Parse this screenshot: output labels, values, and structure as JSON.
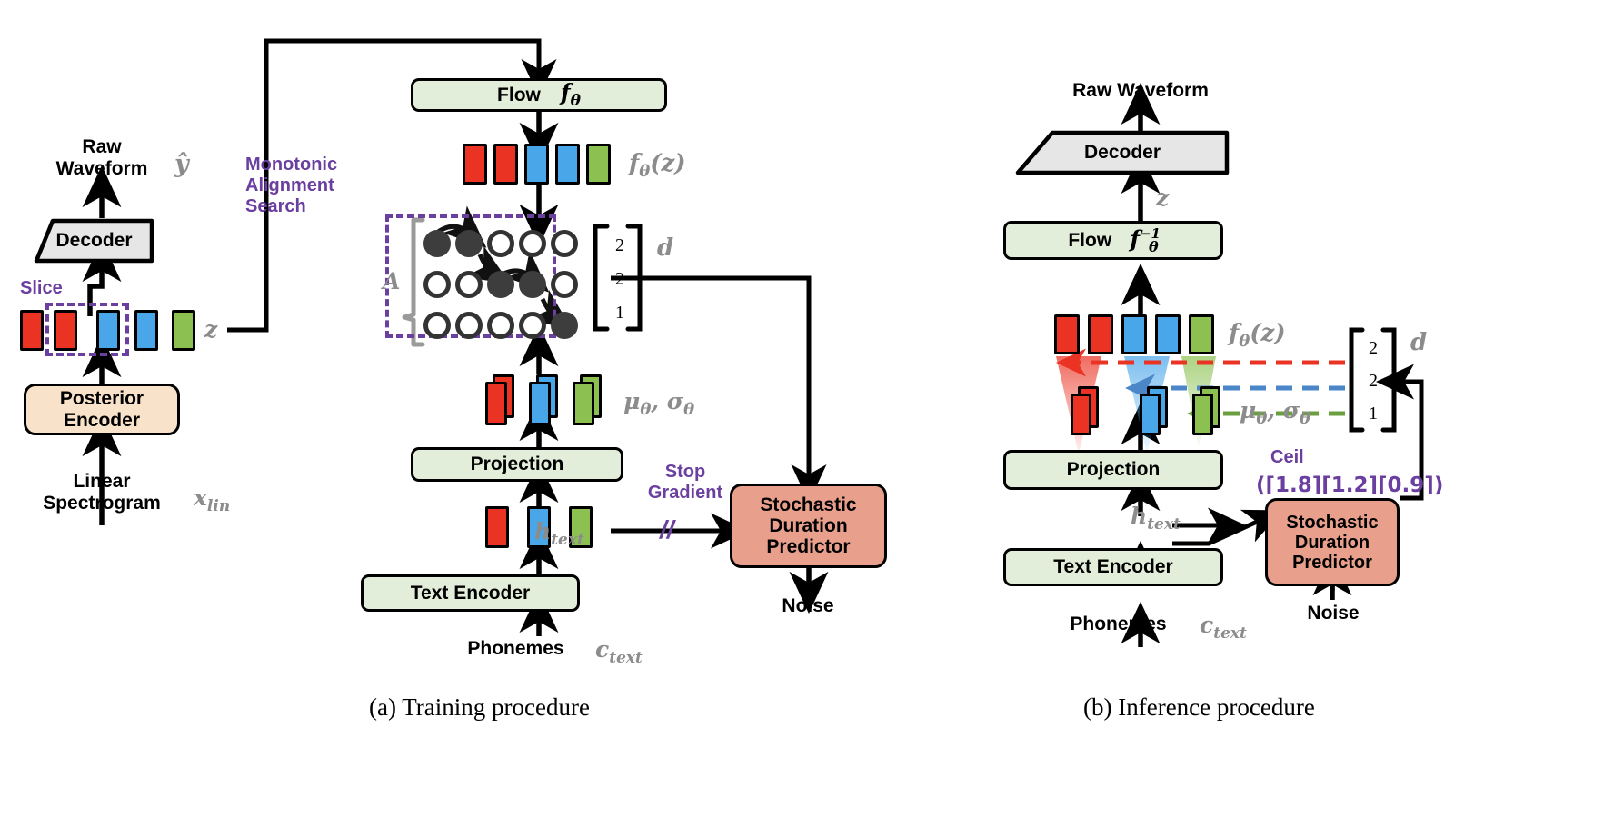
{
  "figure": {
    "captions": [
      {
        "id": "a",
        "text": "(a) Training procedure"
      },
      {
        "id": "b",
        "text": "(b) Inference procedure"
      }
    ]
  },
  "training": {
    "blocks": {
      "decoder": "Decoder",
      "posterior_encoder": "Posterior\nEncoder",
      "flow": "Flow",
      "projection": "Projection",
      "text_encoder": "Text Encoder",
      "stochastic_duration_predictor": "Stochastic\nDuration\nPredictor"
    },
    "io_labels": {
      "raw_waveform": "Raw\nWaveform",
      "linear_spectrogram": "Linear\nSpectrogram",
      "phonemes": "Phonemes",
      "noise": "Noise"
    },
    "annotations": {
      "slice": "Slice",
      "mas": "Monotonic\nAlignment\nSearch",
      "stop_gradient": "Stop\nGradient",
      "stop_gradient_mark": "//"
    },
    "math": {
      "y_hat": "ŷ",
      "z": "z",
      "x_lin": "x",
      "x_lin_sub": "lin",
      "flow_theta": "f",
      "flow_theta_sub": "θ",
      "f_theta_z": "f",
      "f_theta_z_sub": "θ",
      "f_theta_z_arg": "(z)",
      "A": "A",
      "d": "d",
      "mu_sigma": "μ",
      "mu_sigma_sub": "θ",
      "mu_sigma_2": "σ",
      "mu_sigma_2_sub": "θ",
      "h_text": "h",
      "h_text_sub": "text",
      "c_text": "c",
      "c_text_sub": "text"
    },
    "latent_sequence": [
      "red",
      "red",
      "blue",
      "blue",
      "green"
    ],
    "flow_output_sequence": [
      "red",
      "red",
      "blue",
      "blue",
      "green"
    ],
    "text_sequence": [
      "red",
      "blue",
      "green"
    ],
    "mu_sigma_sequence": [
      "red",
      "blue",
      "green"
    ],
    "duration_vector": [
      "2",
      "2",
      "1"
    ],
    "alignment_matrix": {
      "rows": 3,
      "cols": 5,
      "filled": [
        [
          0,
          0
        ],
        [
          0,
          1
        ],
        [
          1,
          2
        ],
        [
          1,
          3
        ],
        [
          2,
          4
        ]
      ]
    }
  },
  "inference": {
    "blocks": {
      "decoder": "Decoder",
      "flow": "Flow",
      "projection": "Projection",
      "text_encoder": "Text Encoder",
      "stochastic_duration_predictor": "Stochastic\nDuration\nPredictor"
    },
    "io_labels": {
      "raw_waveform": "Raw Waveform",
      "phonemes": "Phonemes",
      "noise": "Noise"
    },
    "annotations": {
      "ceil": "Ceil",
      "ceil_expression": "(⌈1.8⌉⌈1.2⌉⌈0.9⌉)",
      "ceil_values": [
        "1.8",
        "1.2",
        "0.9"
      ]
    },
    "math": {
      "z": "z",
      "flow_inv": "f",
      "flow_inv_sub": "θ",
      "flow_inv_sup": "−1",
      "f_theta_z": "f",
      "f_theta_z_sub": "θ",
      "f_theta_z_arg": "(z)",
      "d": "d",
      "mu_sigma": "μ",
      "mu_sigma_sub": "θ",
      "mu_sigma_2": "σ",
      "mu_sigma_2_sub": "θ",
      "h_text": "h",
      "h_text_sub": "text",
      "c_text": "c",
      "c_text_sub": "text"
    },
    "expanded_sequence": [
      "red",
      "red",
      "blue",
      "blue",
      "green"
    ],
    "mu_sigma_sequence": [
      "red",
      "blue",
      "green"
    ],
    "duration_vector": [
      "2",
      "2",
      "1"
    ]
  },
  "colors": {
    "red": "#ea3323",
    "blue": "#49a6e9",
    "green": "#8cc152",
    "purple": "#6b3fa0",
    "green_box": "#e2eed9",
    "salmon_box": "#e8a08c",
    "peach_box": "#f8e2ca",
    "grey_box": "#e6e6e6",
    "math_grey": "#8c8c8c"
  }
}
